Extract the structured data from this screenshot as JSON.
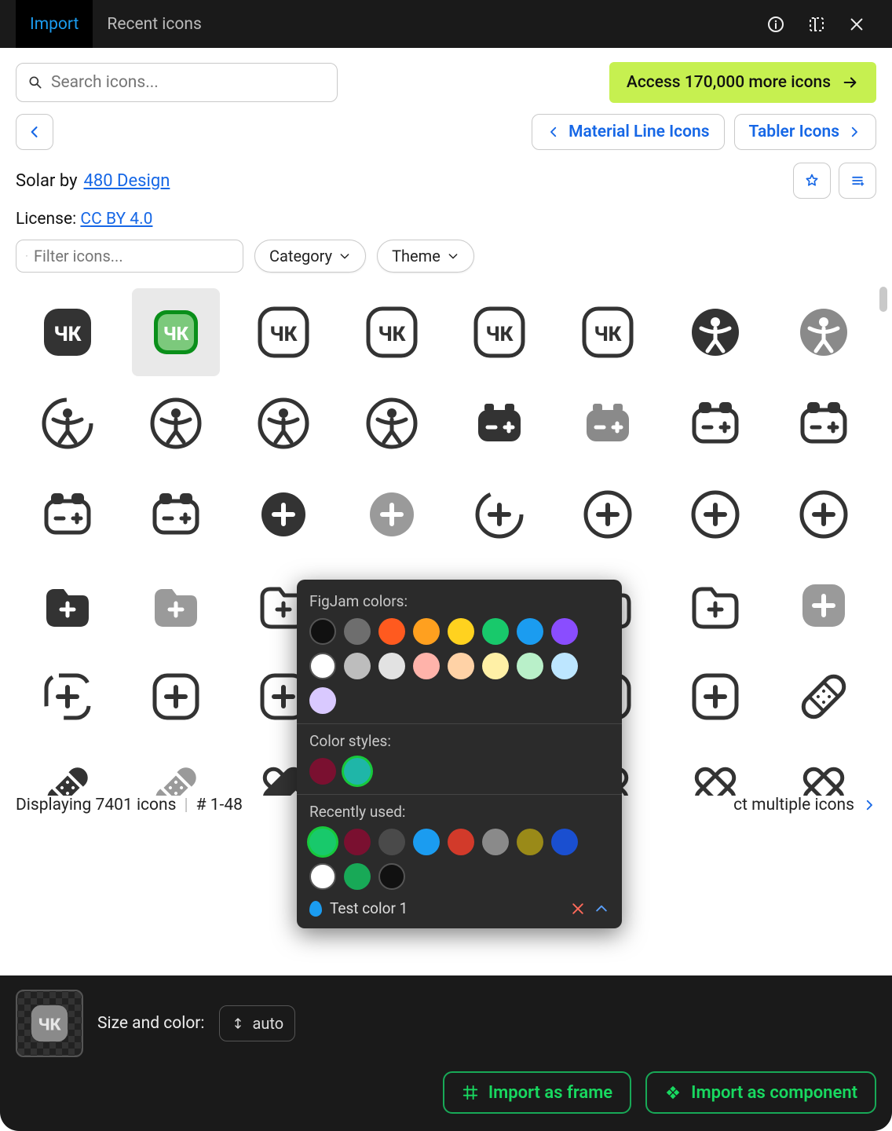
{
  "tabs": {
    "import": "Import",
    "recent": "Recent icons"
  },
  "search": {
    "placeholder": "Search icons..."
  },
  "access": "Access 170,000 more icons",
  "nav": {
    "prev_set": "Material Line Icons",
    "next_set": "Tabler Icons"
  },
  "title": {
    "prefix": "Solar by ",
    "link": "480 Design"
  },
  "license": {
    "prefix": "License: ",
    "link": "CC BY 4.0"
  },
  "filter": {
    "placeholder": "Filter icons...",
    "category": "Category",
    "theme": "Theme"
  },
  "status": {
    "displaying": "Displaying 7401 icons",
    "range": "# 1-48",
    "select_multiple": "ct multiple icons"
  },
  "footer": {
    "size_color": "Size and color:",
    "size_value": "auto",
    "import_frame": "Import as frame",
    "import_component": "Import as component"
  },
  "colorpop": {
    "figjam_label": "FigJam colors:",
    "figjam_colors": [
      "#111111",
      "#6e6e6e",
      "#ff5a1f",
      "#ffa01f",
      "#ffd21f",
      "#18c96b",
      "#1b9cf0",
      "#8a4dff",
      "#ffffff",
      "#bdbdbd",
      "#e2e2e2",
      "#ffb3aa",
      "#ffd2a6",
      "#fff0a6",
      "#b9f0c9",
      "#bde6ff",
      "#d9c9ff"
    ],
    "styles_label": "Color styles:",
    "styles_colors": [
      "#7a1030",
      "#1fb6a8"
    ],
    "recent_label": "Recently used:",
    "recent_colors": [
      "#18c96b",
      "#7a1030",
      "#4a4a4a",
      "#1b9cf0",
      "#d23a2a",
      "#8a8a8a",
      "#9a8a18",
      "#1a4fd0",
      "#ffffff",
      "#18a957",
      "#111111"
    ],
    "selected_style_index": 1,
    "selected_recent_index": 0,
    "footer_label": "Test color 1"
  },
  "icons": [
    {
      "name": "4k-bold",
      "selected": false
    },
    {
      "name": "4k-bold-duotone",
      "selected": true
    },
    {
      "name": "4k-linear",
      "selected": false
    },
    {
      "name": "4k-line-duotone",
      "selected": false
    },
    {
      "name": "4k-outline",
      "selected": false
    },
    {
      "name": "4k-outline-2",
      "selected": false
    },
    {
      "name": "accessibility-bold",
      "selected": false
    },
    {
      "name": "accessibility-bold-duotone",
      "selected": false
    },
    {
      "name": "accessibility-broken",
      "selected": false
    },
    {
      "name": "accessibility-line-duotone",
      "selected": false
    },
    {
      "name": "accessibility-linear",
      "selected": false
    },
    {
      "name": "accessibility-outline",
      "selected": false
    },
    {
      "name": "accumulator-bold",
      "selected": false
    },
    {
      "name": "accumulator-bold-duotone",
      "selected": false
    },
    {
      "name": "accumulator-broken",
      "selected": false
    },
    {
      "name": "accumulator-line-duotone",
      "selected": false
    },
    {
      "name": "accumulator-linear",
      "selected": false
    },
    {
      "name": "accumulator-outline",
      "selected": false
    },
    {
      "name": "add-circle-bold",
      "selected": false
    },
    {
      "name": "add-circle-bold-duotone",
      "selected": false
    },
    {
      "name": "add-circle-broken",
      "selected": false
    },
    {
      "name": "add-circle-line-duotone",
      "selected": false
    },
    {
      "name": "add-circle-linear",
      "selected": false
    },
    {
      "name": "add-circle-outline",
      "selected": false
    },
    {
      "name": "add-folder-bold",
      "selected": false
    },
    {
      "name": "add-folder-bold-duotone",
      "selected": false
    },
    {
      "name": "add-folder-broken",
      "selected": false
    },
    {
      "name": "add-folder-line-duotone",
      "selected": false
    },
    {
      "name": "add-folder-linear",
      "selected": false
    },
    {
      "name": "add-folder-outline",
      "selected": false
    },
    {
      "name": "add-folder-outline-2",
      "selected": false
    },
    {
      "name": "add-square-bold-duotone",
      "selected": false
    },
    {
      "name": "add-square-broken",
      "selected": false
    },
    {
      "name": "add-square-line-duotone",
      "selected": false
    },
    {
      "name": "add-square-linear",
      "selected": false
    },
    {
      "name": "add-square-outline",
      "selected": false
    },
    {
      "name": "add-square-outline-2",
      "selected": false
    },
    {
      "name": "add-square-placeholder",
      "selected": false
    },
    {
      "name": "add-square-placeholder-2",
      "selected": false
    },
    {
      "name": "adhesive-plaster-line-duotone",
      "selected": false
    },
    {
      "name": "adhesive-plaster-bold",
      "selected": false
    },
    {
      "name": "adhesive-plaster-bold-duotone",
      "selected": false
    },
    {
      "name": "adhesive-plaster-2-bold",
      "selected": false
    },
    {
      "name": "adhesive-plaster-2-placeholder",
      "selected": false
    },
    {
      "name": "adhesive-plaster-2-placeholder-2",
      "selected": false
    },
    {
      "name": "adhesive-plaster-2-placeholder-3",
      "selected": false
    },
    {
      "name": "adhesive-plaster-2-placeholder-4",
      "selected": false
    },
    {
      "name": "adhesive-plaster-2-linear",
      "selected": false
    }
  ]
}
